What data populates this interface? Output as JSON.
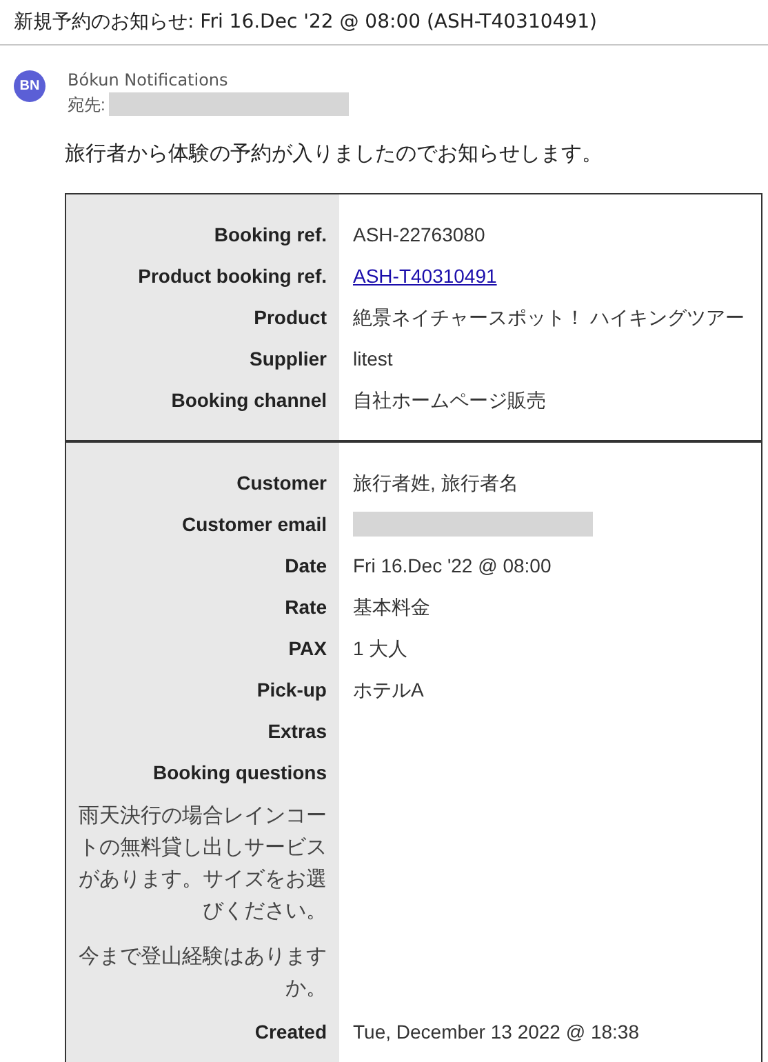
{
  "subject": "新規予約のお知らせ: Fri 16.Dec '22 @ 08:00 (ASH-T40310491)",
  "sender": {
    "initials": "BN",
    "name": "Bókun Notifications",
    "to_label": "宛先:",
    "to_redacted": true
  },
  "intro": "旅行者から体験の予約が入りましたのでお知らせします。",
  "sections": [
    {
      "rows": [
        {
          "kind": "field",
          "label": "Booking ref.",
          "value": "ASH-22763080"
        },
        {
          "kind": "link",
          "label": "Product booking ref.",
          "value": "ASH-T40310491"
        },
        {
          "kind": "field",
          "label": "Product",
          "value": "絶景ネイチャースポット！ ハイキングツアー"
        },
        {
          "kind": "field",
          "label": "Supplier",
          "value": "litest"
        },
        {
          "kind": "field",
          "label": "Booking channel",
          "value": "自社ホームページ販売"
        }
      ]
    },
    {
      "rows": [
        {
          "kind": "field",
          "label": "Customer",
          "value": "旅行者姓, 旅行者名"
        },
        {
          "kind": "redacted",
          "label": "Customer email"
        },
        {
          "kind": "field",
          "label": "Date",
          "value": "Fri 16.Dec '22 @ 08:00"
        },
        {
          "kind": "field",
          "label": "Rate",
          "value": "基本料金"
        },
        {
          "kind": "field",
          "label": "PAX",
          "value": "1 大人"
        },
        {
          "kind": "field",
          "label": "Pick-up",
          "value": "ホテルA"
        },
        {
          "kind": "field",
          "label": "Extras"
        },
        {
          "kind": "field",
          "label": "Booking questions"
        },
        {
          "kind": "question",
          "label": "雨天決行の場合レインコートの無料貸し出しサービスがあります。サイズをお選びください。"
        },
        {
          "kind": "question",
          "label": "今まで登山経験はありますか。"
        },
        {
          "kind": "field",
          "label": "Created",
          "value": "Tue, December 13 2022 @ 18:38"
        }
      ]
    }
  ]
}
